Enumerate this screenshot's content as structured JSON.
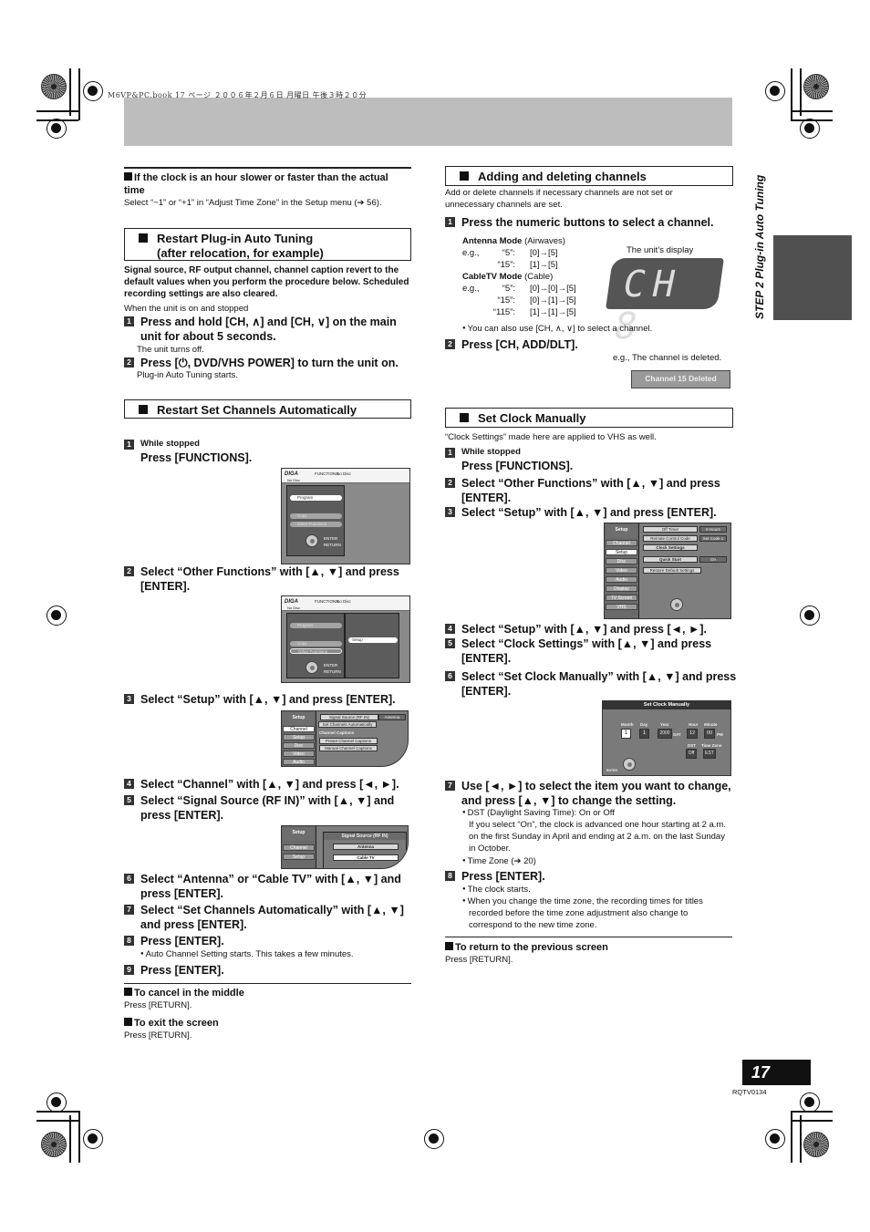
{
  "book_meta": "M6VP&PC.book  17 ページ  ２００６年２月６日  月曜日  午後３時２０分",
  "side_tab": {
    "title": "STEP 2  Plug-in Auto Tuning"
  },
  "page": {
    "number": "17",
    "code": "RQTV0134"
  },
  "left": {
    "clock_tip": {
      "heading": "If the clock is an hour slower or faster than the actual time",
      "body": "Select “−1” or “+1” in “Adjust Time Zone” in the Setup menu (➔ 56)."
    },
    "restart_auto": {
      "heading_line1": "Restart Plug-in Auto Tuning",
      "heading_line2": "(after relocation, for example)",
      "warning": "Signal source, RF output channel, channel caption revert to the default values when you perform the procedure below. Scheduled recording settings are also cleared.",
      "condition": "When the unit is on and stopped",
      "steps": [
        {
          "num": "1",
          "text": "Press and hold [CH, ∧] and [CH, ∨] on the main unit for about 5 seconds.",
          "note": "The unit turns off."
        },
        {
          "num": "2",
          "text": "Press [⏻, DVD/VHS POWER] to turn the unit on.",
          "note": "Plug-in Auto Tuning starts."
        }
      ]
    },
    "restart_channels": {
      "heading": "Restart Set Channels Automatically",
      "steps": [
        {
          "num": "1",
          "pre": "While stopped",
          "text": "Press [FUNCTIONS]."
        },
        {
          "num": "2",
          "text": "Select “Other Functions” with [▲, ▼] and press [ENTER]."
        },
        {
          "num": "3",
          "text": "Select “Setup” with [▲, ▼] and press [ENTER]."
        },
        {
          "num": "4",
          "text": "Select “Channel” with [▲, ▼] and press [◄, ►]."
        },
        {
          "num": "5",
          "text": "Select “Signal Source (RF IN)” with [▲, ▼] and press [ENTER]."
        },
        {
          "num": "6",
          "text": "Select “Antenna” or “Cable TV” with [▲, ▼] and press [ENTER]."
        },
        {
          "num": "7",
          "text": "Select “Set Channels Automatically” with [▲, ▼] and press [ENTER]."
        },
        {
          "num": "8",
          "text": "Press [ENTER].",
          "note": "Auto Channel Setting starts. This takes a few minutes."
        },
        {
          "num": "9",
          "text": "Press [ENTER]."
        }
      ],
      "cancel": {
        "heading": "To cancel in the middle",
        "body": "Press [RETURN]."
      },
      "exit": {
        "heading": "To exit the screen",
        "body": "Press [RETURN]."
      }
    },
    "osd_functions": {
      "title": "FUNCTIONS",
      "disc": "No Disc",
      "sub": "No Disc",
      "items": [
        "Program",
        "Copy",
        "Other Functions"
      ],
      "enter": "ENTER",
      "return": "RETURN",
      "submenu": "Setup"
    },
    "osd_setup_channel": {
      "title": "Setup",
      "tabs": [
        "Channel",
        "Setup",
        "Disc",
        "Video",
        "Audio"
      ],
      "options": [
        "Signal Source (RF IN)",
        "Set Channels Automatically",
        "Channel Captions",
        "Preset Channel Captions",
        "Manual Channel Captions"
      ],
      "signal_value": "Antenna"
    },
    "osd_signal_source": {
      "title": "Setup",
      "tabs": [
        "Channel",
        "Setup"
      ],
      "dialog_title": "Signal Source (RF IN)",
      "choices": [
        "Antenna",
        "Cable TV"
      ]
    }
  },
  "right": {
    "add_delete": {
      "heading": "Adding and deleting channels",
      "intro": "Add or delete channels if necessary channels are not set or unnecessary channels are set.",
      "step1": "Press the numeric buttons to select a channel.",
      "antenna_mode": {
        "label": "Antenna Mode",
        "paren": "(Airwaves)",
        "examples": [
          {
            "eg": "e.g.,",
            "ch": "“5”:",
            "keys": "[0]→[5]"
          },
          {
            "eg": "",
            "ch": "“15”:",
            "keys": "[1]→[5]"
          }
        ]
      },
      "cable_mode": {
        "label": "CableTV Mode",
        "paren": "(Cable)",
        "examples": [
          {
            "eg": "e.g.,",
            "ch": "“5”:",
            "keys": "[0]→[0]→[5]"
          },
          {
            "eg": "",
            "ch": "“15”:",
            "keys": "[0]→[1]→[5]"
          },
          {
            "eg": "",
            "ch": "“115”:",
            "keys": "[1]→[1]→[5]"
          }
        ]
      },
      "display_caption": "The unit’s display",
      "display_text": "CH 8",
      "tip": "You can also use [CH, ∧, ∨] to select a channel.",
      "step2": "Press [CH, ADD/DLT].",
      "deleted_caption": "e.g., The channel is deleted.",
      "deleted_banner": "Channel 15 Deleted"
    },
    "set_clock": {
      "heading": "Set Clock Manually",
      "intro": "“Clock Settings” made here are applied to VHS as well.",
      "steps": [
        {
          "num": "1",
          "pre": "While stopped",
          "text": "Press [FUNCTIONS]."
        },
        {
          "num": "2",
          "text": "Select “Other Functions” with [▲, ▼] and press [ENTER]."
        },
        {
          "num": "3",
          "text": "Select “Setup” with [▲, ▼] and press [ENTER]."
        },
        {
          "num": "4",
          "text": "Select “Setup” with [▲, ▼] and press [◄, ►]."
        },
        {
          "num": "5",
          "text": "Select “Clock Settings” with [▲, ▼] and press [ENTER]."
        },
        {
          "num": "6",
          "text": "Select “Set Clock Manually” with [▲, ▼] and press [ENTER]."
        },
        {
          "num": "7",
          "text": "Use [◄, ►] to select the item you want to change, and press [▲, ▼] to change the setting."
        },
        {
          "num": "8",
          "text": "Press [ENTER]."
        }
      ],
      "step7_notes": {
        "dst": "DST (Daylight Saving Time): On or Off",
        "dst_detail": "If you select “On”, the clock is advanced one hour starting at 2 a.m. on the first Sunday in April and ending at 2 a.m. on the last Sunday in October.",
        "tz": "Time Zone (➔ 20)"
      },
      "step8_notes": [
        "The clock starts.",
        "When you change the time zone, the recording times for titles recorded before the time zone adjustment also change to correspond to the new time zone."
      ],
      "return": {
        "heading": "To return to the previous screen",
        "body": "Press [RETURN]."
      }
    },
    "osd_setup_setup": {
      "title": "Setup",
      "tabs": [
        "Channel",
        "Setup",
        "Disc",
        "Video",
        "Audio",
        "Display",
        "TV Screen",
        "VHS"
      ],
      "options": [
        {
          "label": "Off Timer",
          "value": "6 Hours"
        },
        {
          "label": "Remote Control Code",
          "value": "Set Code 1"
        },
        {
          "label": "Clock Settings",
          "value": ""
        },
        {
          "label": "Quick Start",
          "value": "On"
        },
        {
          "label": "Restore Default Settings",
          "value": ""
        }
      ]
    },
    "osd_clock": {
      "title": "Set Clock Manually",
      "fields": [
        {
          "label": "Month",
          "value": "1"
        },
        {
          "label": "Day",
          "value": "1"
        },
        {
          "label": "Year",
          "value": "2000",
          "suffix": "SAT"
        },
        {
          "label": "Hour",
          "value": "12"
        },
        {
          "label": "Minute",
          "value": "00",
          "suffix": "PM"
        },
        {
          "label": "DST",
          "value": "Off"
        },
        {
          "label": "Time Zone",
          "value": "EST"
        }
      ],
      "enter": "ENTER"
    }
  }
}
